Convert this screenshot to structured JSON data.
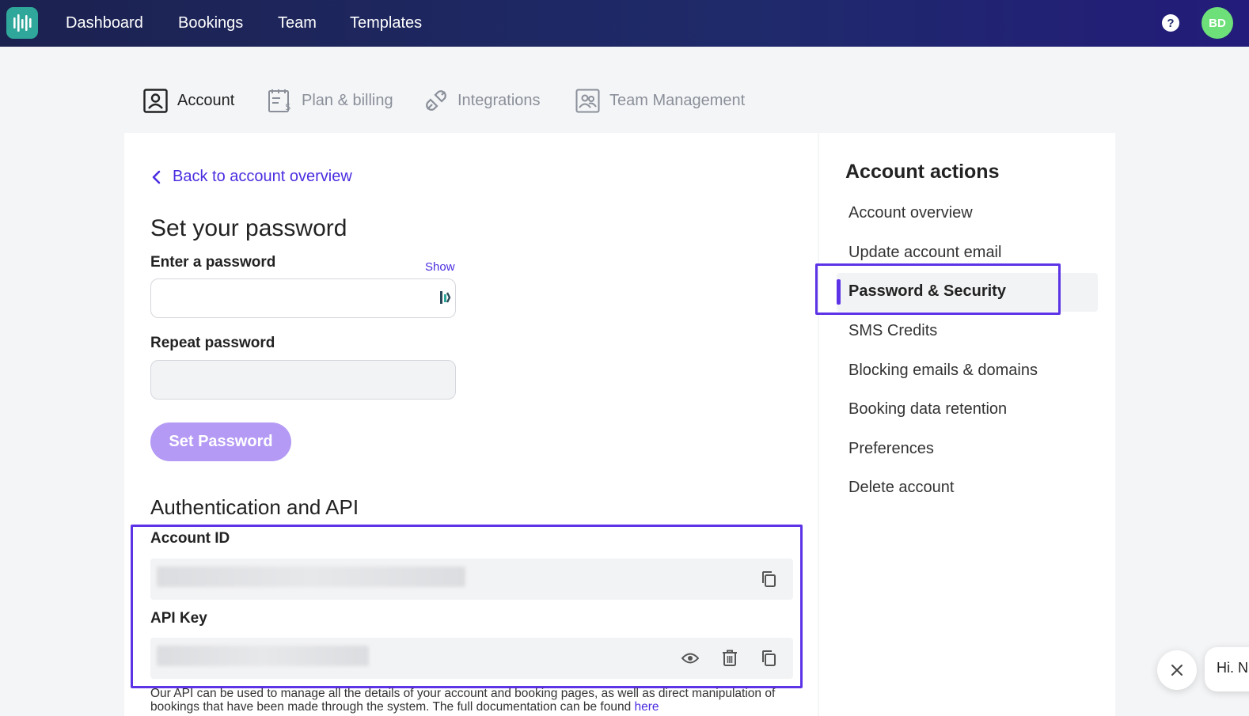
{
  "topnav": {
    "items": [
      {
        "label": "Dashboard"
      },
      {
        "label": "Bookings"
      },
      {
        "label": "Team"
      },
      {
        "label": "Templates"
      }
    ],
    "help_label": "?",
    "avatar_initials": "BD"
  },
  "tabs": [
    {
      "label": "Account",
      "active": true
    },
    {
      "label": "Plan & billing"
    },
    {
      "label": "Integrations"
    },
    {
      "label": "Team Management"
    }
  ],
  "main": {
    "back_label": "Back to account overview",
    "password_title": "Set your password",
    "enter_label": "Enter a password",
    "show_label": "Show",
    "repeat_label": "Repeat password",
    "set_button": "Set Password",
    "auth_title": "Authentication and API",
    "account_id_label": "Account ID",
    "api_key_label": "API Key",
    "api_note_text": "Our API can be used to manage all the details of your account and booking pages, as well as direct manipulation of bookings that have been made through the system. The full documentation can be found ",
    "api_note_link": "here"
  },
  "side": {
    "title": "Account actions",
    "items": [
      {
        "label": "Account overview"
      },
      {
        "label": "Update account email"
      },
      {
        "label": "Password & Security",
        "active": true
      },
      {
        "label": "SMS Credits"
      },
      {
        "label": "Blocking emails & domains"
      },
      {
        "label": "Booking data retention"
      },
      {
        "label": "Preferences"
      },
      {
        "label": "Delete account"
      }
    ]
  },
  "chat": {
    "greeting": "Hi. N"
  },
  "colors": {
    "accent": "#5c33e6",
    "link": "#4b2de0",
    "button_disabled": "#b49af5",
    "topbar": "#1f2a6b",
    "avatar": "#6ee07a",
    "logo": "#2fa79a"
  }
}
